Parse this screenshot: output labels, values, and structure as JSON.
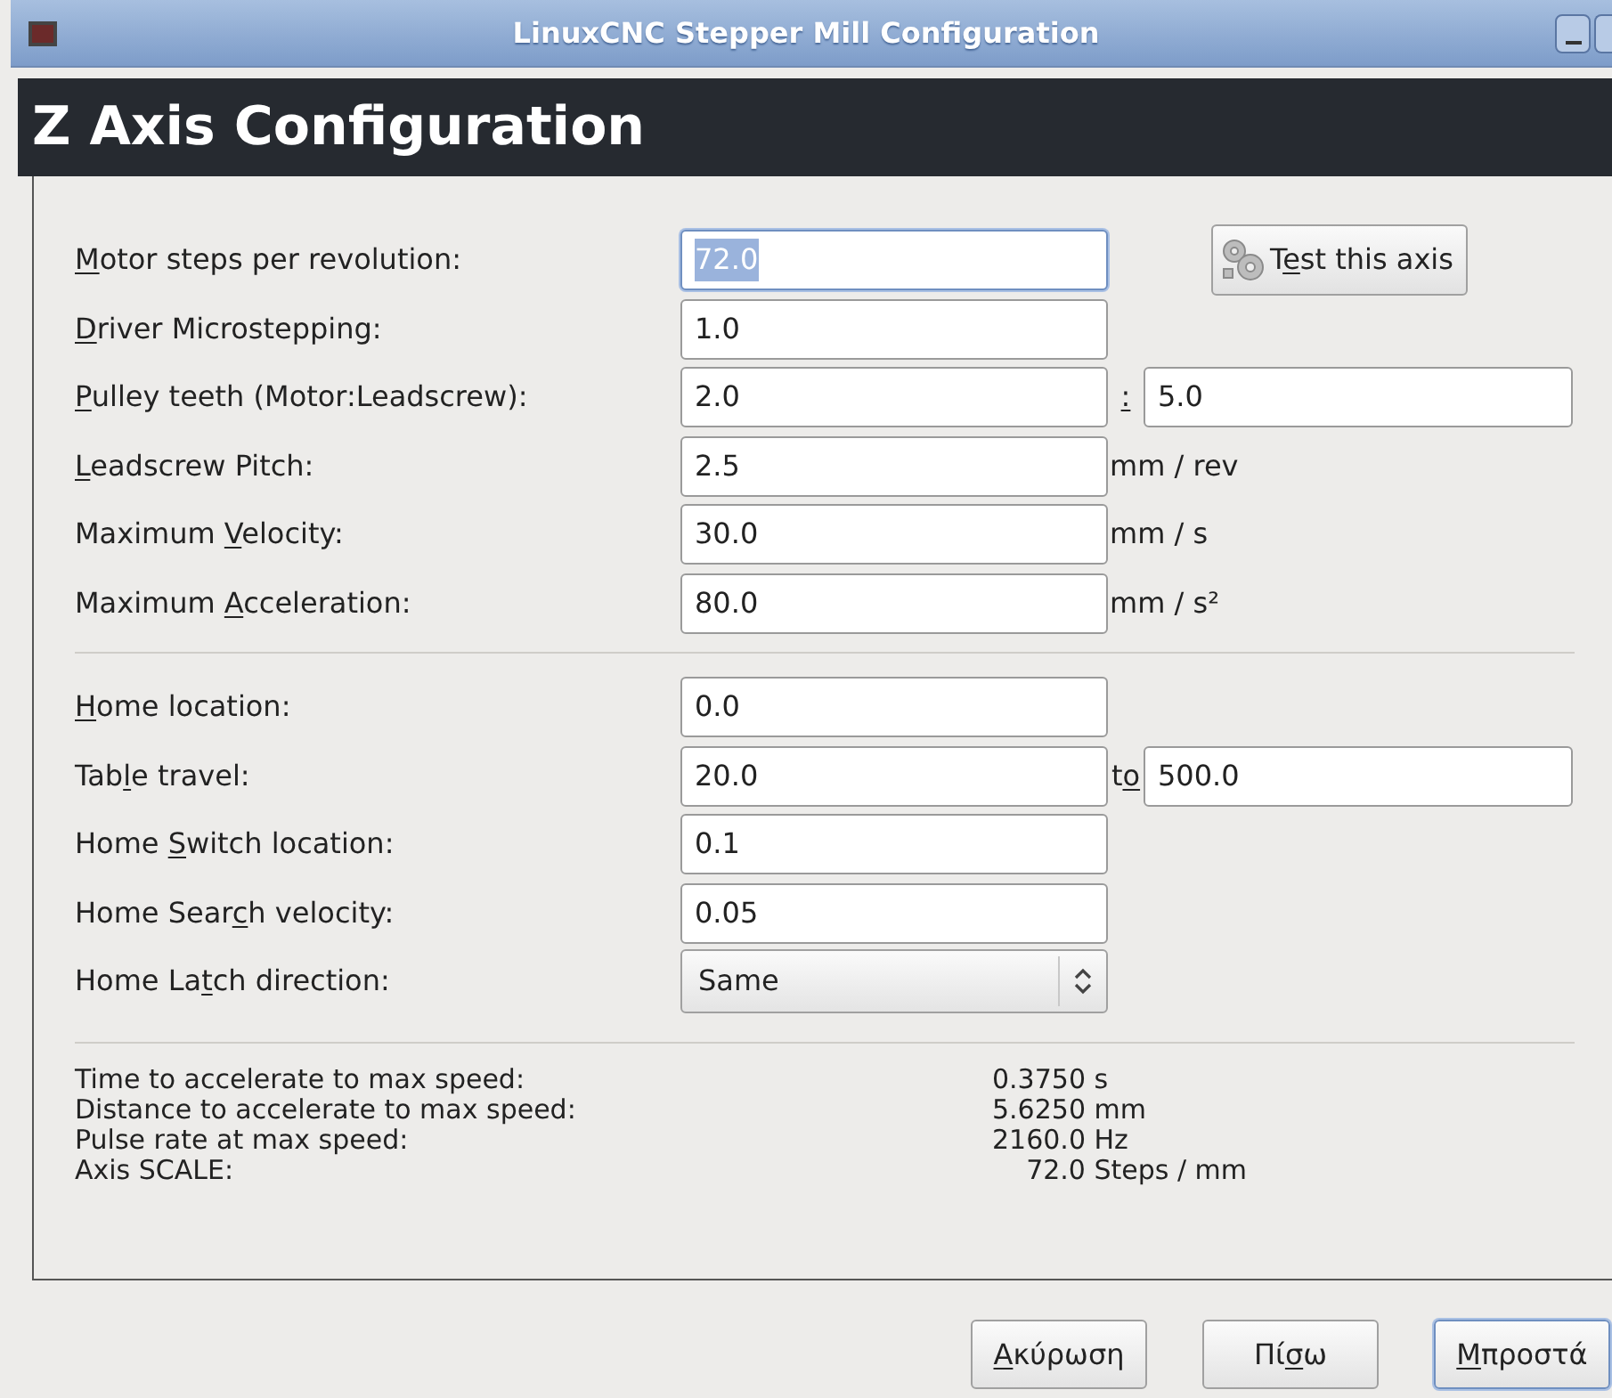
{
  "window": {
    "title": "LinuxCNC Stepper Mill Configuration"
  },
  "header": {
    "title": "Z Axis Configuration"
  },
  "test_button": {
    "label": {
      "pre": "T",
      "key": "e",
      "post": "st this axis"
    }
  },
  "sections": [
    {
      "rows": [
        {
          "kind": "entry",
          "label": {
            "key": "M",
            "post": "otor steps per revolution:"
          },
          "value": "72.0",
          "focused": true
        },
        {
          "kind": "entry",
          "label": {
            "key": "D",
            "post": "river Microstepping:"
          },
          "value": "1.0",
          "focused": false
        },
        {
          "kind": "pair",
          "label": {
            "key": "P",
            "post": "ulley teeth (Motor:Leadscrew):"
          },
          "value": "2.0",
          "focused": false,
          "joiner": {
            "key": ":"
          },
          "value2": "5.0"
        },
        {
          "kind": "entry",
          "label": {
            "key": "L",
            "post": "eadscrew Pitch:"
          },
          "value": "2.5",
          "focused": false,
          "unit": "mm / rev"
        },
        {
          "kind": "entry",
          "label": {
            "pre": "Maximum ",
            "key": "V",
            "post": "elocity:"
          },
          "value": "30.0",
          "focused": false,
          "unit": "mm / s"
        },
        {
          "kind": "entry",
          "label": {
            "pre": "Maximum ",
            "key": "A",
            "post": "cceleration:"
          },
          "value": "80.0",
          "focused": false,
          "unit": "mm / s²"
        }
      ]
    },
    {
      "rows": [
        {
          "kind": "entry",
          "label": {
            "key": "H",
            "post": "ome location:"
          },
          "value": "0.0",
          "focused": false
        },
        {
          "kind": "pair",
          "label": {
            "pre": "Tab",
            "key": "l",
            "post": "e travel:"
          },
          "value": "20.0",
          "focused": false,
          "joiner": {
            "pre": "t",
            "key": "o"
          },
          "value2": "500.0"
        },
        {
          "kind": "entry",
          "label": {
            "pre": "Home ",
            "key": "S",
            "post": "witch location:"
          },
          "value": "0.1",
          "focused": false
        },
        {
          "kind": "entry",
          "label": {
            "pre": "Home Sear",
            "key": "c",
            "post": "h velocity:"
          },
          "value": "0.05",
          "focused": false
        },
        {
          "kind": "combo",
          "label": {
            "pre": "Home La",
            "key": "t",
            "post": "ch direction:"
          },
          "value": "Same"
        }
      ]
    }
  ],
  "results": [
    {
      "label": "Time to accelerate to max speed:",
      "value": "0.3750 s"
    },
    {
      "label": "Distance to accelerate to max speed:",
      "value": "5.6250 mm"
    },
    {
      "label": "Pulse rate at max speed:",
      "value": "2160.0 Hz"
    },
    {
      "label": "Axis SCALE:",
      "value": "    72.0 Steps / mm"
    }
  ],
  "buttons": [
    {
      "label": {
        "key": "Α",
        "post": "κύρωση"
      },
      "default": false
    },
    {
      "label": {
        "pre": "Πί",
        "key": "σ",
        "post": "ω"
      },
      "default": false
    },
    {
      "label": {
        "key": "Μ",
        "post": "προστά"
      },
      "default": true
    }
  ]
}
